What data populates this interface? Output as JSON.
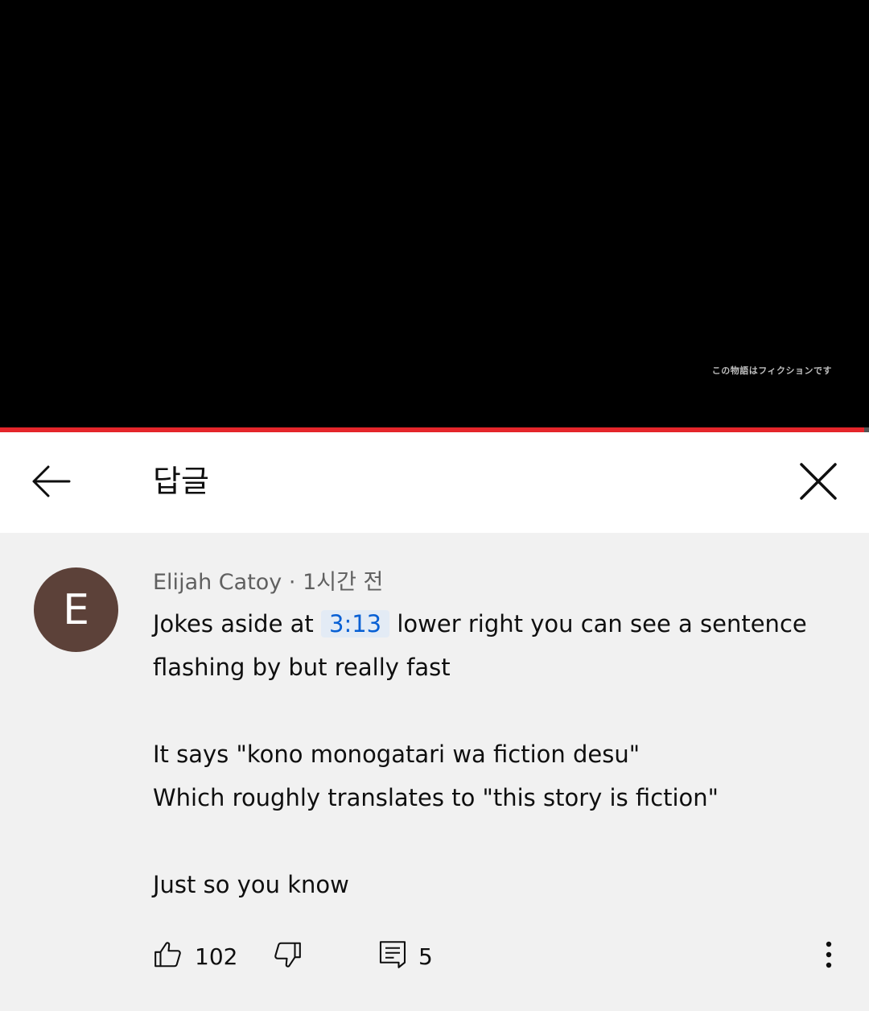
{
  "video": {
    "caption": "この物語はフィクションです",
    "progress_percent": 99.4,
    "progress_color": "#e5262b"
  },
  "header": {
    "title": "답글",
    "back_icon": "arrow-left-icon",
    "close_icon": "close-icon"
  },
  "comment": {
    "avatar_letter": "E",
    "avatar_color": "#5c4139",
    "author": "Elijah Catoy",
    "separator": "·",
    "time": "1시간 전",
    "text_before_timestamp": "Jokes aside at ",
    "timestamp": "3:13",
    "text_after_timestamp": " lower right you can see a sentence flashing by but really fast",
    "paragraph2_line1": "It says \"kono monogatari wa fiction desu\"",
    "paragraph2_line2": "Which roughly translates to \"this story is fiction\"",
    "paragraph3": "Just so you know"
  },
  "actions": {
    "like_count": "102",
    "reply_count": "5",
    "like_icon": "thumbs-up-icon",
    "dislike_icon": "thumbs-down-icon",
    "reply_icon": "reply-icon",
    "more_icon": "more-vertical-icon"
  }
}
